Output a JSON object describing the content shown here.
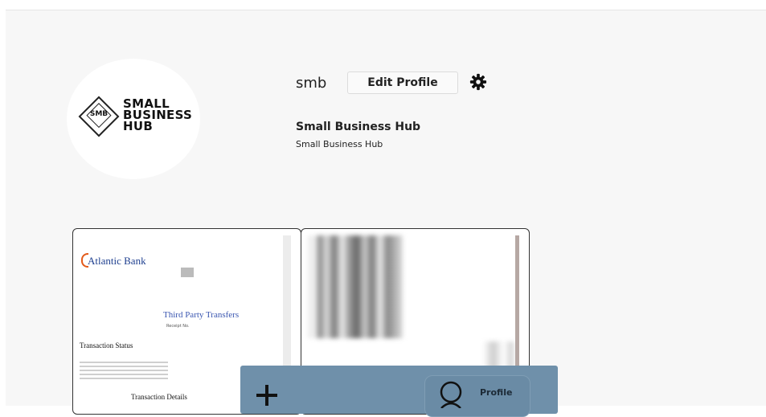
{
  "profile": {
    "username": "smb",
    "edit_label": "Edit Profile",
    "display_name": "Small Business Hub",
    "bio": "Small Business Hub",
    "settings_icon": "gear-icon",
    "avatar_logo": {
      "badge": "SMB",
      "lines": [
        "SMALL",
        "BUSINESS",
        "HUB"
      ]
    }
  },
  "posts": [
    {
      "bank_name": "Atlantic Bank",
      "title": "Third Party Transfers",
      "subtitle": "Receipt No.",
      "status_heading": "Transaction Status",
      "details_heading": "Transaction Details"
    },
    {}
  ],
  "bottom_nav": {
    "add_icon": "plus-icon",
    "profile_icon": "user-icon",
    "profile_label": "Profile"
  },
  "colors": {
    "background": "#f7f7f7",
    "nav_bar": "#6f90aa",
    "bank_brand": "#1e3f8f"
  }
}
